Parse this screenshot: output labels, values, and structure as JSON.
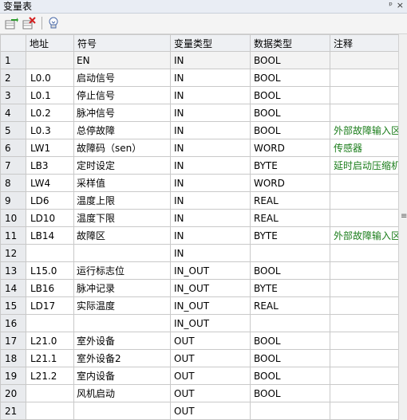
{
  "window": {
    "title": "变量表",
    "pin_glyph": "ᵖ",
    "close_glyph": "×"
  },
  "toolbar": {
    "buttons": [
      {
        "name": "insert-row-icon"
      },
      {
        "name": "delete-row-icon"
      },
      {
        "name": "bulb-icon"
      }
    ]
  },
  "table": {
    "columns": [
      "地址",
      "符号",
      "变量类型",
      "数据类型",
      "注释"
    ],
    "rows": [
      {
        "num": "1",
        "addr": "",
        "sym": "EN",
        "var": "IN",
        "dt": "BOOL",
        "comment": ""
      },
      {
        "num": "2",
        "addr": "L0.0",
        "sym": "启动信号",
        "var": "IN",
        "dt": "BOOL",
        "comment": ""
      },
      {
        "num": "3",
        "addr": "L0.1",
        "sym": "停止信号",
        "var": "IN",
        "dt": "BOOL",
        "comment": ""
      },
      {
        "num": "4",
        "addr": "L0.2",
        "sym": "脉冲信号",
        "var": "IN",
        "dt": "BOOL",
        "comment": ""
      },
      {
        "num": "5",
        "addr": "L0.3",
        "sym": "总停故障",
        "var": "IN",
        "dt": "BOOL",
        "comment": "外部故障输入区"
      },
      {
        "num": "6",
        "addr": "LW1",
        "sym": "故障码（sen）",
        "var": "IN",
        "dt": "WORD",
        "comment": "传感器"
      },
      {
        "num": "7",
        "addr": "LB3",
        "sym": "定时设定",
        "var": "IN",
        "dt": "BYTE",
        "comment": "延时启动压缩机"
      },
      {
        "num": "8",
        "addr": "LW4",
        "sym": "采样值",
        "var": "IN",
        "dt": "WORD",
        "comment": ""
      },
      {
        "num": "9",
        "addr": "LD6",
        "sym": "温度上限",
        "var": "IN",
        "dt": "REAL",
        "comment": ""
      },
      {
        "num": "10",
        "addr": "LD10",
        "sym": "温度下限",
        "var": "IN",
        "dt": "REAL",
        "comment": ""
      },
      {
        "num": "11",
        "addr": "LB14",
        "sym": "故障区",
        "var": "IN",
        "dt": "BYTE",
        "comment": "外部故障输入区"
      },
      {
        "num": "12",
        "addr": "",
        "sym": "",
        "var": "IN",
        "dt": "",
        "comment": ""
      },
      {
        "num": "13",
        "addr": "L15.0",
        "sym": "运行标志位",
        "var": "IN_OUT",
        "dt": "BOOL",
        "comment": ""
      },
      {
        "num": "14",
        "addr": "LB16",
        "sym": "脉冲记录",
        "var": "IN_OUT",
        "dt": "BYTE",
        "comment": ""
      },
      {
        "num": "15",
        "addr": "LD17",
        "sym": "实际温度",
        "var": "IN_OUT",
        "dt": "REAL",
        "comment": ""
      },
      {
        "num": "16",
        "addr": "",
        "sym": "",
        "var": "IN_OUT",
        "dt": "",
        "comment": ""
      },
      {
        "num": "17",
        "addr": "L21.0",
        "sym": "室外设备",
        "var": "OUT",
        "dt": "BOOL",
        "comment": ""
      },
      {
        "num": "18",
        "addr": "L21.1",
        "sym": "室外设备2",
        "var": "OUT",
        "dt": "BOOL",
        "comment": ""
      },
      {
        "num": "19",
        "addr": "L21.2",
        "sym": "室内设备",
        "var": "OUT",
        "dt": "BOOL",
        "comment": ""
      },
      {
        "num": "20",
        "addr": "",
        "sym": "风机启动",
        "var": "OUT",
        "dt": "BOOL",
        "comment": ""
      },
      {
        "num": "21",
        "addr": "",
        "sym": "",
        "var": "OUT",
        "dt": "",
        "comment": ""
      }
    ]
  },
  "colors": {
    "comment": "#1a7d1a",
    "header_bg": "#eef0f3",
    "rowhead_bg": "#e9ebee"
  }
}
